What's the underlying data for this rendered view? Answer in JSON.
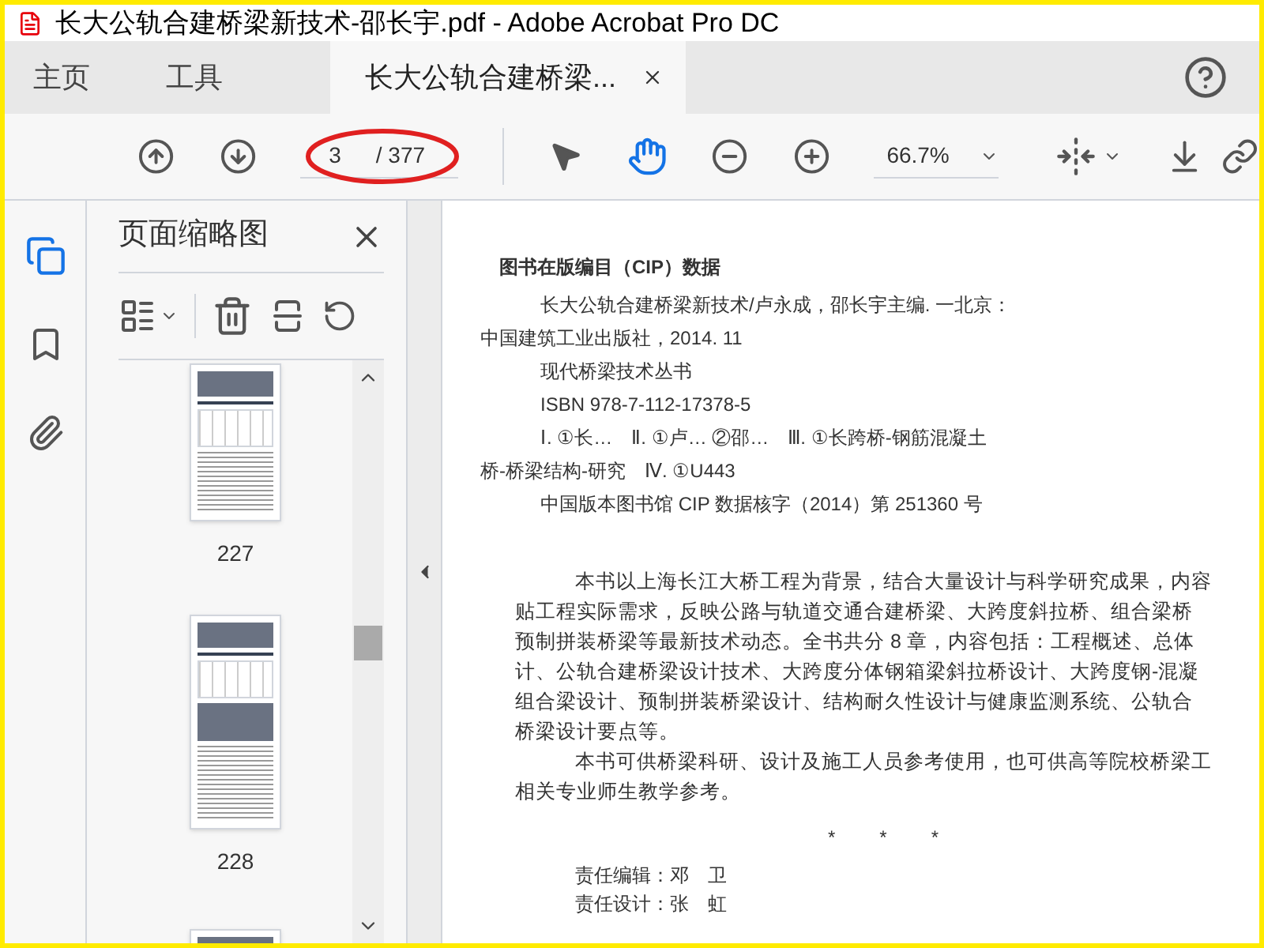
{
  "window": {
    "title": "长大公轨合建桥梁新技术-邵长宇.pdf - Adobe Acrobat Pro DC"
  },
  "tabs": [
    {
      "label": "主页",
      "kind": "nav",
      "selected": false
    },
    {
      "label": "工具",
      "kind": "nav",
      "selected": false
    },
    {
      "label": "长大公轨合建桥梁...",
      "kind": "document",
      "selected": true
    }
  ],
  "toolbar": {
    "page_current": "3",
    "page_total": "/ 377",
    "zoom": "66.7%",
    "hand_tool_active": true
  },
  "thumbnails_panel": {
    "title": "页面缩略图",
    "pages": [
      {
        "label": "227"
      },
      {
        "label": "228"
      }
    ]
  },
  "document": {
    "cip_title": "图书在版编目（CIP）数据",
    "cip_lines": [
      {
        "text": "长大公轨合建桥梁新技术/卢永成，邵长宇主编. 一北京：",
        "kind": "indented"
      },
      {
        "text": "中国建筑工业出版社，2014. 11",
        "kind": "continuation"
      },
      {
        "text": "现代桥梁技术丛书",
        "kind": "indented"
      },
      {
        "text": "ISBN 978-7-112-17378-5",
        "kind": "indented"
      },
      {
        "text": "Ⅰ. ①长…　Ⅱ. ①卢…  ②邵…　Ⅲ. ①长跨桥-钢筋混凝土",
        "kind": "indented"
      },
      {
        "text": "桥-桥梁结构-研究　Ⅳ. ①U443",
        "kind": "continuation"
      },
      {
        "text": "中国版本图书馆 CIP 数据核字（2014）第 251360 号",
        "kind": "indented"
      }
    ],
    "body_lines": [
      {
        "text": "本书以上海长江大桥工程为背景，结合大量设计与科学研究成果，内容",
        "kind": "indented"
      },
      {
        "text": "贴工程实际需求，反映公路与轨道交通合建桥梁、大跨度斜拉桥、组合梁桥",
        "kind": "continuation"
      },
      {
        "text": "预制拼装桥梁等最新技术动态。全书共分 8 章，内容包括：工程概述、总体",
        "kind": "continuation"
      },
      {
        "text": "计、公轨合建桥梁设计技术、大跨度分体钢箱梁斜拉桥设计、大跨度钢-混凝",
        "kind": "continuation"
      },
      {
        "text": "组合梁设计、预制拼装桥梁设计、结构耐久性设计与健康监测系统、公轨合",
        "kind": "continuation"
      },
      {
        "text": "桥梁设计要点等。",
        "kind": "continuation"
      },
      {
        "text": "本书可供桥梁科研、设计及施工人员参考使用，也可供高等院校桥梁工",
        "kind": "indented"
      },
      {
        "text": "相关专业师生教学参考。",
        "kind": "continuation"
      }
    ],
    "separator": [
      "*",
      "*",
      "*"
    ],
    "credits": [
      "责任编辑：邓　卫",
      "责任设计：张　虹"
    ]
  }
}
